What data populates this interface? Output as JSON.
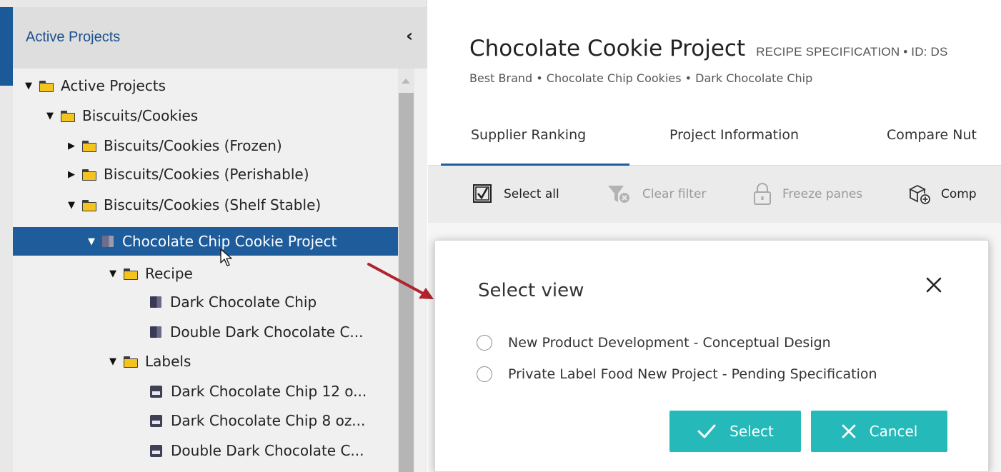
{
  "sidebar": {
    "header_title": "Active Projects",
    "collapse_icon": "chevron-left-icon",
    "tree": [
      {
        "label": "Active Projects",
        "icon": "folder-icon",
        "expand": "expanded"
      },
      {
        "label": "Biscuits/Cookies",
        "icon": "folder-icon",
        "expand": "expanded"
      },
      {
        "label": "Biscuits/Cookies (Frozen)",
        "icon": "folder-icon",
        "expand": "collapsed"
      },
      {
        "label": "Biscuits/Cookies (Perishable)",
        "icon": "folder-icon",
        "expand": "collapsed"
      },
      {
        "label": "Biscuits/Cookies (Shelf Stable)",
        "icon": "folder-icon",
        "expand": "expanded"
      },
      {
        "label": "Chocolate Chip Cookie Project",
        "icon": "project-cube-icon",
        "expand": "expanded",
        "selected": true
      },
      {
        "label": "Recipe",
        "icon": "folder-icon",
        "expand": "expanded"
      },
      {
        "label": "Dark Chocolate Chip",
        "icon": "recipe-cube-icon"
      },
      {
        "label": "Double Dark Chocolate C...",
        "icon": "recipe-cube-icon"
      },
      {
        "label": "Labels",
        "icon": "folder-icon",
        "expand": "expanded"
      },
      {
        "label": "Dark Chocolate Chip 12 o...",
        "icon": "label-icon"
      },
      {
        "label": "Dark Chocolate Chip 8 oz...",
        "icon": "label-icon"
      },
      {
        "label": "Double Dark Chocolate C...",
        "icon": "label-icon"
      }
    ]
  },
  "header": {
    "title": "Chocolate Cookie Project",
    "meta": "RECIPE SPECIFICATION  •  ID: DS",
    "breadcrumb": "Best Brand  •  Chocolate Chip Cookies  •  Dark Chocolate Chip"
  },
  "tabs": [
    {
      "label": "Supplier Ranking",
      "active": true
    },
    {
      "label": "Project Information",
      "active": false
    },
    {
      "label": "Compare Nut",
      "active": false
    }
  ],
  "toolbar": {
    "select_all": "Select all",
    "clear_filter": "Clear filter",
    "freeze_panes": "Freeze panes",
    "compare": "Comp"
  },
  "modal": {
    "title": "Select view",
    "options": [
      "New Product Development - Conceptual Design",
      "Private Label Food New Project - Pending Specification"
    ],
    "select_label": "Select",
    "cancel_label": "Cancel"
  },
  "colors": {
    "accent_blue": "#1f5c9c",
    "teal_button": "#26b9b9",
    "arrow_red": "#b0242e",
    "folder_yellow": "#f2c41d"
  }
}
